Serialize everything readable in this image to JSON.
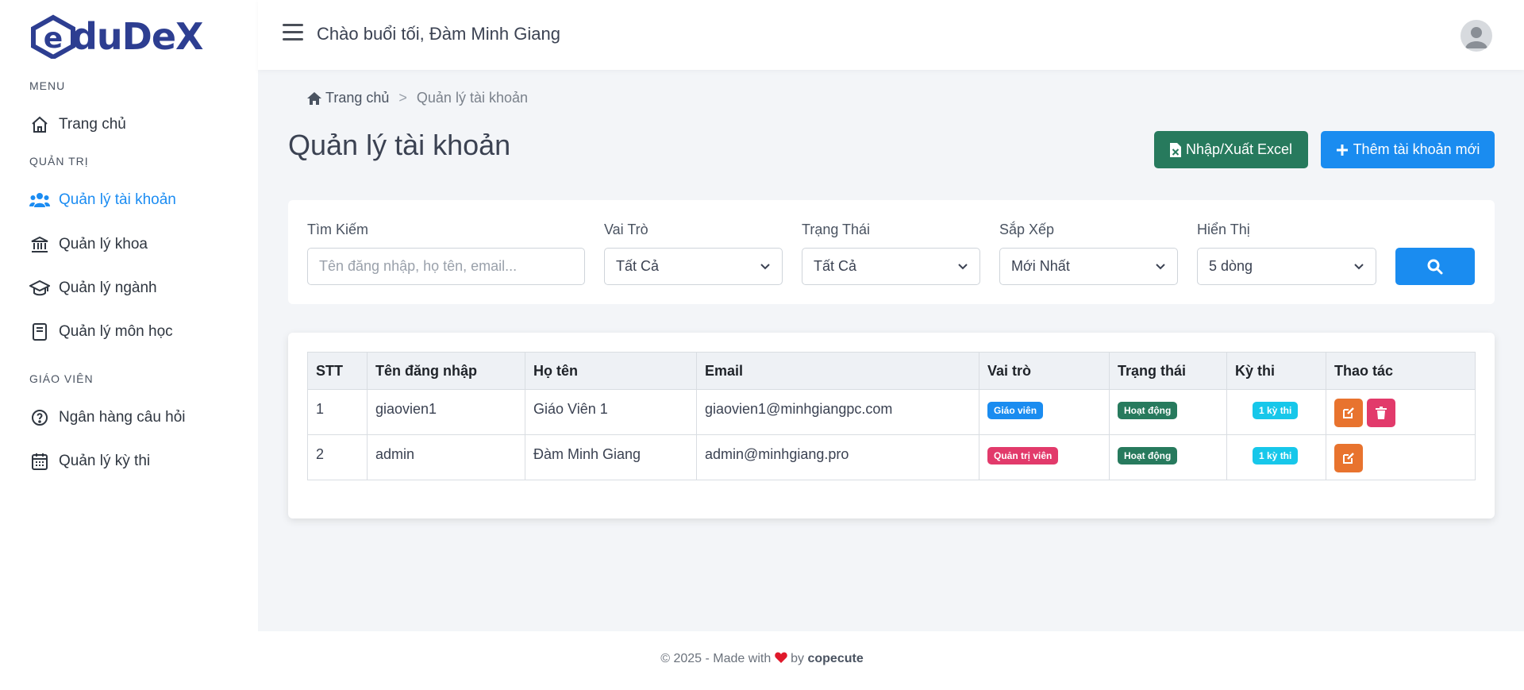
{
  "brand": {
    "logo_text": "duDeX",
    "logo_letter": "e",
    "colors": {
      "primary": "#1a8cf0",
      "excel": "#277a5d",
      "brand": "#2d3e91"
    }
  },
  "topbar": {
    "greeting": "Chào buổi tối, Đàm Minh Giang"
  },
  "sidebar": {
    "sections": [
      {
        "title": "MENU"
      },
      {
        "title": "QUẢN TRỊ"
      },
      {
        "title": "GIÁO VIÊN"
      }
    ],
    "items": [
      {
        "label": "Trang chủ",
        "icon": "home-icon"
      },
      {
        "label": "Quản lý tài khoản",
        "icon": "users-icon",
        "active": true
      },
      {
        "label": "Quản lý khoa",
        "icon": "bank-icon"
      },
      {
        "label": "Quản lý ngành",
        "icon": "graduation-cap-icon"
      },
      {
        "label": "Quản lý môn học",
        "icon": "book-icon"
      },
      {
        "label": "Ngân hàng câu hỏi",
        "icon": "question-circle-icon"
      },
      {
        "label": "Quản lý kỳ thi",
        "icon": "calendar-icon"
      }
    ]
  },
  "breadcrumb": {
    "home": "Trang chủ",
    "separator": ">",
    "current": "Quản lý tài khoản"
  },
  "page": {
    "title": "Quản lý tài khoản",
    "excel_button": "Nhập/Xuất Excel",
    "add_button": "Thêm tài khoản mới"
  },
  "filters": {
    "search": {
      "label": "Tìm Kiếm",
      "placeholder": "Tên đăng nhập, họ tên, email..."
    },
    "role": {
      "label": "Vai Trò",
      "value": "Tất Cả"
    },
    "status": {
      "label": "Trạng Thái",
      "value": "Tất Cả"
    },
    "sort": {
      "label": "Sắp Xếp",
      "value": "Mới Nhất"
    },
    "display": {
      "label": "Hiển Thị",
      "value": "5 dòng"
    }
  },
  "table": {
    "headers": [
      "STT",
      "Tên đăng nhập",
      "Họ tên",
      "Email",
      "Vai trò",
      "Trạng thái",
      "Kỳ thi",
      "Thao tác"
    ],
    "rows": [
      {
        "stt": "1",
        "username": "giaovien1",
        "fullname": "Giáo Viên 1",
        "email": "giaovien1@minhgiangpc.com",
        "role": "Giáo viên",
        "role_color": "#1a8cf0",
        "status": "Hoạt động",
        "exams": "1 kỳ thi",
        "can_delete": true
      },
      {
        "stt": "2",
        "username": "admin",
        "fullname": "Đàm Minh Giang",
        "email": "admin@minhgiang.pro",
        "role": "Quản trị viên",
        "role_color": "#e23a6b",
        "status": "Hoạt động",
        "exams": "1 kỳ thi",
        "can_delete": false
      }
    ]
  },
  "footer": {
    "prefix": "© 2025 - Made with",
    "by": "by",
    "author": "copecute"
  }
}
